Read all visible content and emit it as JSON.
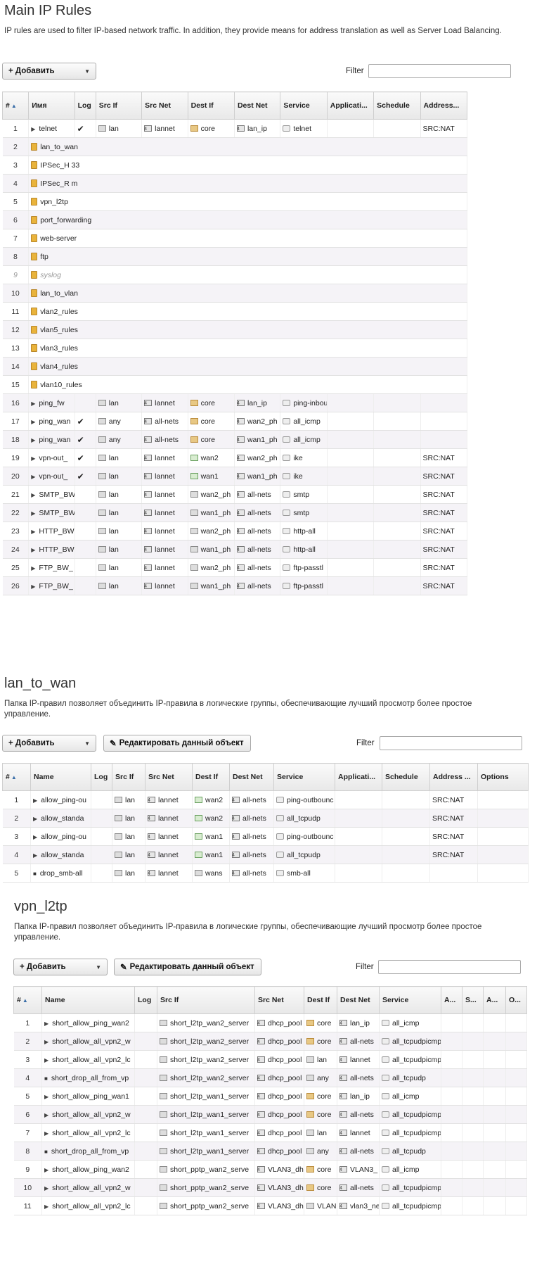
{
  "main": {
    "title": "Main IP Rules",
    "description": "IP rules are used to filter IP-based network traffic. In addition, they provide means for address translation as well as Server Load Balancing.",
    "add_label": "+ Добавить",
    "filter_label": "Filter",
    "columns": [
      "#",
      "Имя",
      "Log",
      "Src If",
      "Src Net",
      "Dest If",
      "Dest Net",
      "Service",
      "Applicati...",
      "Schedule",
      "Address..."
    ],
    "rows": [
      {
        "n": "1",
        "kind": "rule",
        "name": "telnet",
        "log": "✔",
        "srcif": "lan",
        "srcnet": "lannet",
        "destif": "core",
        "destnet": "lan_ip",
        "service": "telnet",
        "addr": "SRC:NAT"
      },
      {
        "n": "2",
        "kind": "folder",
        "name": "lan_to_wan"
      },
      {
        "n": "3",
        "kind": "folder",
        "name": "IPSec_H        33"
      },
      {
        "n": "4",
        "kind": "folder",
        "name": "IPSec_R        m"
      },
      {
        "n": "5",
        "kind": "folder",
        "name": "vpn_l2tp"
      },
      {
        "n": "6",
        "kind": "folder",
        "name": "port_forwarding"
      },
      {
        "n": "7",
        "kind": "folder",
        "name": "web-server"
      },
      {
        "n": "8",
        "kind": "folder",
        "name": "ftp"
      },
      {
        "n": "9",
        "kind": "folder",
        "name": "syslog",
        "disabled": true
      },
      {
        "n": "10",
        "kind": "folder",
        "name": "lan_to_vlan"
      },
      {
        "n": "11",
        "kind": "folder",
        "name": "vlan2_rules"
      },
      {
        "n": "12",
        "kind": "folder",
        "name": "vlan5_rules"
      },
      {
        "n": "13",
        "kind": "folder",
        "name": "vlan3_rules"
      },
      {
        "n": "14",
        "kind": "folder",
        "name": "vlan4_rules"
      },
      {
        "n": "15",
        "kind": "folder",
        "name": "vlan10_rules"
      },
      {
        "n": "16",
        "kind": "rule",
        "name": "ping_fw",
        "log": "",
        "srcif": "lan",
        "srcnet": "lannet",
        "destif": "core",
        "destnet": "lan_ip",
        "service": "ping-inbou",
        "addr": ""
      },
      {
        "n": "17",
        "kind": "rule",
        "name": "ping_wan",
        "log": "✔",
        "srcif": "any",
        "srcnet": "all-nets",
        "destif": "core",
        "destnet": "wan2_ph",
        "service": "all_icmp",
        "addr": ""
      },
      {
        "n": "18",
        "kind": "rule",
        "name": "ping_wan",
        "log": "✔",
        "srcif": "any",
        "srcnet": "all-nets",
        "destif": "core",
        "destnet": "wan1_ph",
        "service": "all_icmp",
        "addr": ""
      },
      {
        "n": "19",
        "kind": "rule",
        "name": "vpn-out_",
        "log": "✔",
        "srcif": "lan",
        "srcnet": "lannet",
        "destif": "wan2",
        "destnet": "wan2_ph",
        "service": "ike",
        "addr": "SRC:NAT"
      },
      {
        "n": "20",
        "kind": "rule",
        "name": "vpn-out_",
        "log": "✔",
        "srcif": "lan",
        "srcnet": "lannet",
        "destif": "wan1",
        "destnet": "wan1_ph",
        "service": "ike",
        "addr": "SRC:NAT"
      },
      {
        "n": "21",
        "kind": "rule",
        "name": "SMTP_BW",
        "log": "",
        "srcif": "lan",
        "srcnet": "lannet",
        "destif": "wan2_ph",
        "destnet": "all-nets",
        "service": "smtp",
        "addr": "SRC:NAT"
      },
      {
        "n": "22",
        "kind": "rule",
        "name": "SMTP_BW",
        "log": "",
        "srcif": "lan",
        "srcnet": "lannet",
        "destif": "wan1_ph",
        "destnet": "all-nets",
        "service": "smtp",
        "addr": "SRC:NAT"
      },
      {
        "n": "23",
        "kind": "rule",
        "name": "HTTP_BW",
        "log": "",
        "srcif": "lan",
        "srcnet": "lannet",
        "destif": "wan2_ph",
        "destnet": "all-nets",
        "service": "http-all",
        "addr": "SRC:NAT"
      },
      {
        "n": "24",
        "kind": "rule",
        "name": "HTTP_BW",
        "log": "",
        "srcif": "lan",
        "srcnet": "lannet",
        "destif": "wan1_ph",
        "destnet": "all-nets",
        "service": "http-all",
        "addr": "SRC:NAT"
      },
      {
        "n": "25",
        "kind": "rule",
        "name": "FTP_BW_",
        "log": "",
        "srcif": "lan",
        "srcnet": "lannet",
        "destif": "wan2_ph",
        "destnet": "all-nets",
        "service": "ftp-passtl",
        "addr": "SRC:NAT"
      },
      {
        "n": "26",
        "kind": "rule",
        "name": "FTP_BW_",
        "log": "",
        "srcif": "lan",
        "srcnet": "lannet",
        "destif": "wan1_ph",
        "destnet": "all-nets",
        "service": "ftp-passtl",
        "addr": "SRC:NAT"
      }
    ]
  },
  "lan_to_wan": {
    "title": "lan_to_wan",
    "description": "Папка IP-правил позволяет объединить IP-правила в логические группы, обеспечивающие лучший просмотр более простое управление.",
    "add_label": "+ Добавить",
    "edit_label": "Редактировать данный объект",
    "filter_label": "Filter",
    "columns": [
      "#",
      "Name",
      "Log",
      "Src If",
      "Src Net",
      "Dest If",
      "Dest Net",
      "Service",
      "Applicati...",
      "Schedule",
      "Address ...",
      "Options"
    ],
    "rows": [
      {
        "n": "1",
        "action": "allow",
        "name": "allow_ping-ou",
        "srcif": "lan",
        "srcnet": "lannet",
        "destif": "wan2",
        "destnet": "all-nets",
        "service": "ping-outbounc",
        "addr": "SRC:NAT"
      },
      {
        "n": "2",
        "action": "allow",
        "name": "allow_standa",
        "srcif": "lan",
        "srcnet": "lannet",
        "destif": "wan2",
        "destnet": "all-nets",
        "service": "all_tcpudp",
        "addr": "SRC:NAT"
      },
      {
        "n": "3",
        "action": "allow",
        "name": "allow_ping-ou",
        "srcif": "lan",
        "srcnet": "lannet",
        "destif": "wan1",
        "destnet": "all-nets",
        "service": "ping-outbounc",
        "addr": "SRC:NAT"
      },
      {
        "n": "4",
        "action": "allow",
        "name": "allow_standa",
        "srcif": "lan",
        "srcnet": "lannet",
        "destif": "wan1",
        "destnet": "all-nets",
        "service": "all_tcpudp",
        "addr": "SRC:NAT"
      },
      {
        "n": "5",
        "action": "drop",
        "name": "drop_smb-all",
        "srcif": "lan",
        "srcnet": "lannet",
        "destif": "wans",
        "destnet": "all-nets",
        "service": "smb-all",
        "addr": ""
      }
    ]
  },
  "vpn_l2tp": {
    "title": "vpn_l2tp",
    "description": "Папка IP-правил позволяет объединить IP-правила в логические группы, обеспечивающие лучший просмотр более простое управление.",
    "add_label": "+ Добавить",
    "edit_label": "Редактировать данный объект",
    "filter_label": "Filter",
    "columns": [
      "#",
      "Name",
      "Log",
      "Src If",
      "Src Net",
      "Dest If",
      "Dest Net",
      "Service",
      "A...",
      "S...",
      "A...",
      "O..."
    ],
    "rows": [
      {
        "n": "1",
        "action": "allow",
        "name": "short_allow_ping_wan2",
        "srcif": "short_l2tp_wan2_server",
        "srcnet": "dhcp_pool",
        "destif": "core",
        "destnet": "lan_ip",
        "service": "all_icmp"
      },
      {
        "n": "2",
        "action": "allow",
        "name": "short_allow_all_vpn2_w",
        "srcif": "short_l2tp_wan2_server",
        "srcnet": "dhcp_pool",
        "destif": "core",
        "destnet": "all-nets",
        "service": "all_tcpudpicmp"
      },
      {
        "n": "3",
        "action": "allow",
        "name": "short_allow_all_vpn2_lc",
        "srcif": "short_l2tp_wan2_server",
        "srcnet": "dhcp_pool",
        "destif": "lan",
        "destnet": "lannet",
        "service": "all_tcpudpicmp"
      },
      {
        "n": "4",
        "action": "drop",
        "name": "short_drop_all_from_vp",
        "srcif": "short_l2tp_wan2_server",
        "srcnet": "dhcp_pool",
        "destif": "any",
        "destnet": "all-nets",
        "service": "all_tcpudp"
      },
      {
        "n": "5",
        "action": "allow",
        "name": "short_allow_ping_wan1",
        "srcif": "short_l2tp_wan1_server",
        "srcnet": "dhcp_pool",
        "destif": "core",
        "destnet": "lan_ip",
        "service": "all_icmp"
      },
      {
        "n": "6",
        "action": "allow",
        "name": "short_allow_all_vpn2_w",
        "srcif": "short_l2tp_wan1_server",
        "srcnet": "dhcp_pool",
        "destif": "core",
        "destnet": "all-nets",
        "service": "all_tcpudpicmp"
      },
      {
        "n": "7",
        "action": "allow",
        "name": "short_allow_all_vpn2_lc",
        "srcif": "short_l2tp_wan1_server",
        "srcnet": "dhcp_pool",
        "destif": "lan",
        "destnet": "lannet",
        "service": "all_tcpudpicmp"
      },
      {
        "n": "8",
        "action": "drop",
        "name": "short_drop_all_from_vp",
        "srcif": "short_l2tp_wan1_server",
        "srcnet": "dhcp_pool",
        "destif": "any",
        "destnet": "all-nets",
        "service": "all_tcpudp"
      },
      {
        "n": "9",
        "action": "allow",
        "name": "short_allow_ping_wan2",
        "srcif": "short_pptp_wan2_serve",
        "srcnet": "VLAN3_dh",
        "destif": "core",
        "destnet": "VLAN3_",
        "service": "all_icmp"
      },
      {
        "n": "10",
        "action": "allow",
        "name": "short_allow_all_vpn2_w",
        "srcif": "short_pptp_wan2_serve",
        "srcnet": "VLAN3_dh",
        "destif": "core",
        "destnet": "all-nets",
        "service": "all_tcpudpicmp"
      },
      {
        "n": "11",
        "action": "allow",
        "name": "short_allow_all_vpn2_lc",
        "srcif": "short_pptp_wan2_serve",
        "srcnet": "VLAN3_dh",
        "destif": "VLAN",
        "destnet": "vlan3_ne",
        "service": "all_tcpudpicmp"
      }
    ]
  }
}
